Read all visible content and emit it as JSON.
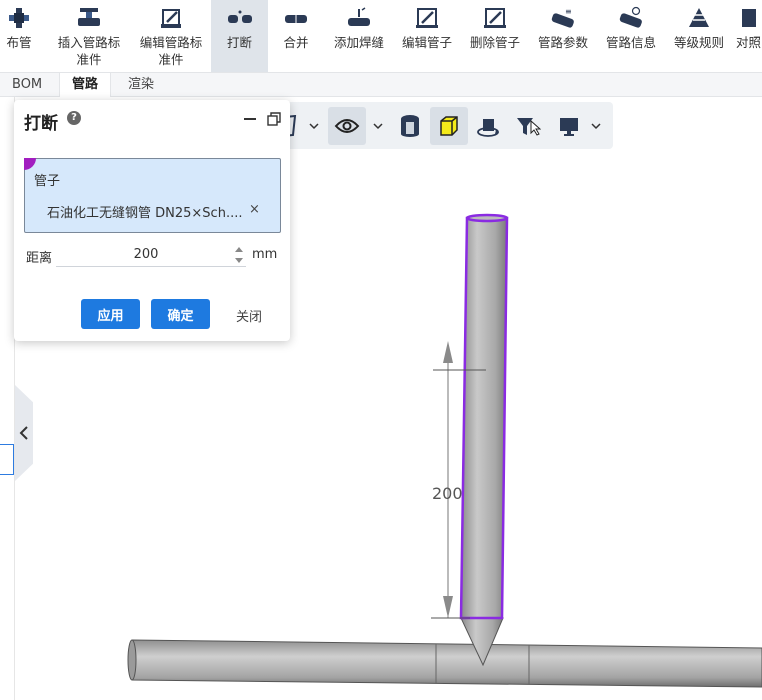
{
  "ribbon": {
    "items": [
      {
        "label": "布管",
        "icon": "pipe-layout-icon"
      },
      {
        "label": "插入管路标准件",
        "line1": "插入管路标",
        "line2": "准件",
        "icon": "insert-fitting-icon"
      },
      {
        "label": "编辑管路标准件",
        "line1": "编辑管路标",
        "line2": "准件",
        "icon": "edit-fitting-icon"
      },
      {
        "label": "打断",
        "icon": "break-pipe-icon"
      },
      {
        "label": "合并",
        "icon": "merge-pipe-icon"
      },
      {
        "label": "添加焊缝",
        "icon": "weld-icon"
      },
      {
        "label": "编辑管子",
        "icon": "edit-pipe-icon"
      },
      {
        "label": "删除管子",
        "icon": "delete-pipe-icon"
      },
      {
        "label": "管路参数",
        "icon": "pipe-params-icon"
      },
      {
        "label": "管路信息",
        "icon": "pipe-info-icon"
      },
      {
        "label": "等级规则",
        "icon": "grade-rules-icon"
      },
      {
        "label": "对照",
        "icon": "compare-icon"
      }
    ]
  },
  "tabs": [
    {
      "label": "BOM"
    },
    {
      "label": "管路"
    },
    {
      "label": "渲染"
    }
  ],
  "dialog": {
    "title": "打断",
    "help": "?",
    "pick_label": "管子",
    "pick_item": "石油化工无缝钢管 DN25×Sch....",
    "remove": "×",
    "distance_label": "距离",
    "distance_value": "200",
    "distance_unit": "mm",
    "apply_label": "应用",
    "ok_label": "确定",
    "close_label": "关闭"
  },
  "viewport": {
    "dimension_text": "200"
  },
  "colors": {
    "accent": "#1e7ae0",
    "selection": "#8a2be2",
    "active_tool": "#dfe4ea",
    "pick_box": "#d6e8fb"
  }
}
